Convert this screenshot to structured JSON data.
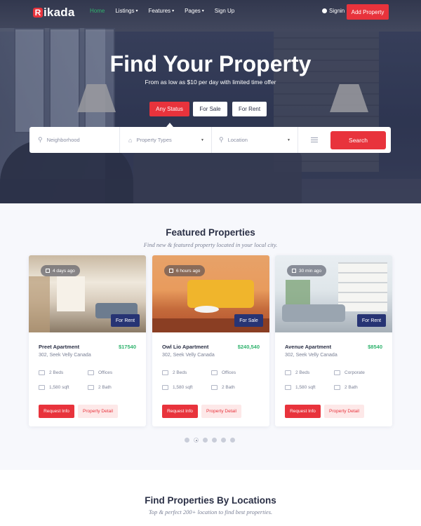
{
  "header": {
    "logo_letter": "R",
    "logo_text": "ikada",
    "nav": [
      {
        "label": "Home",
        "active": true,
        "dropdown": false
      },
      {
        "label": "Listings",
        "active": false,
        "dropdown": true
      },
      {
        "label": "Features",
        "active": false,
        "dropdown": true
      },
      {
        "label": "Pages",
        "active": false,
        "dropdown": true
      },
      {
        "label": "Sign Up",
        "active": false,
        "dropdown": false
      }
    ],
    "signin_label": "Signin",
    "add_property_label": "Add Property"
  },
  "hero": {
    "title": "Find Your Property",
    "subtitle": "From as low as $10 per day with limited time offer",
    "status_tabs": [
      "Any Status",
      "For Sale",
      "For Rent"
    ],
    "selected_status": "Any Status"
  },
  "search": {
    "neighborhood_placeholder": "Neighborhood",
    "property_types_label": "Property Types",
    "location_label": "Location",
    "search_label": "Search"
  },
  "featured": {
    "title": "Featured Properties",
    "subtitle": "Find new & featured property located in your local city.",
    "cards": [
      {
        "time": "4 days ago",
        "tag": "For Rent",
        "name": "Preet Apartment",
        "price": "$17540",
        "address": "302, Seek Velly Canada",
        "beds": "2 Beds",
        "type": "Offices",
        "area": "1,580 sqft",
        "bath": "2 Bath",
        "request_label": "Request Info",
        "detail_label": "Property Detail"
      },
      {
        "time": "6 hours ago",
        "tag": "For Sale",
        "name": "Owl Lio Apartment",
        "price": "$240,540",
        "address": "302, Seek Velly Canada",
        "beds": "2 Beds",
        "type": "Offices",
        "area": "1,580 sqft",
        "bath": "2 Bath",
        "request_label": "Request Info",
        "detail_label": "Property Detail"
      },
      {
        "time": "30 min ago",
        "tag": "For Rent",
        "name": "Avenue Apartment",
        "price": "$8540",
        "address": "302, Seek Velly Canada",
        "beds": "2 Beds",
        "type": "Corporate",
        "area": "1,580 sqft",
        "bath": "2 Bath",
        "request_label": "Request Info",
        "detail_label": "Property Detail"
      }
    ],
    "pagination_count": 6,
    "pagination_active": 2
  },
  "locations": {
    "title": "Find Properties By Locations",
    "subtitle": "Top & perfect 200+ location to find best properties."
  },
  "colors": {
    "accent": "#e8333c",
    "price_green": "#2fb36d",
    "badge_navy": "#273474"
  },
  "icons": [
    "search-icon",
    "building-icon",
    "map-pin-icon",
    "filter-icon",
    "user-icon",
    "calendar-icon",
    "bed-icon",
    "office-icon",
    "area-icon",
    "bath-icon"
  ]
}
